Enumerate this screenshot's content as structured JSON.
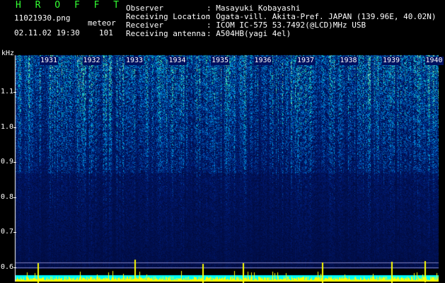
{
  "header": {
    "brand": "H R O F F T",
    "filename": "11021930.png",
    "mode": "meteor",
    "datetime": "02.11.02 19:30",
    "count": "101"
  },
  "station": {
    "observer_label": "Observer",
    "observer_value": ": Masayuki Kobayashi",
    "location_label": "Receiving Location",
    "location_value": ": Ogata-vill. Akita-Pref. JAPAN (139.96E, 40.02N)",
    "receiver_label": "Receiver",
    "receiver_value": ": ICOM IC-575 53.7492(@LCD)MHz USB",
    "antenna_label": "Receiving antenna",
    "antenna_value": ": A504HB(yagi 4el)"
  },
  "yaxis": {
    "unit": "kHz",
    "ticks": [
      {
        "label": "1.1",
        "value": 1.1
      },
      {
        "label": "1.0",
        "value": 1.0
      },
      {
        "label": "0.9",
        "value": 0.9
      },
      {
        "label": "0.8",
        "value": 0.8
      },
      {
        "label": "0.7",
        "value": 0.7
      },
      {
        "label": "0.6",
        "value": 0.6
      }
    ]
  },
  "timeaxis": {
    "labels": [
      "1931",
      "1932",
      "1933",
      "1934",
      "1935",
      "1936",
      "1937",
      "1938",
      "1939",
      "1940"
    ]
  },
  "colors": {
    "background": "#000000",
    "brand": "#33ff33",
    "low": "#001070",
    "mid": "#1a7fd0",
    "high": "#5fe0a0",
    "peak": "#ffff00",
    "bottom_band": "#00ffff"
  }
}
